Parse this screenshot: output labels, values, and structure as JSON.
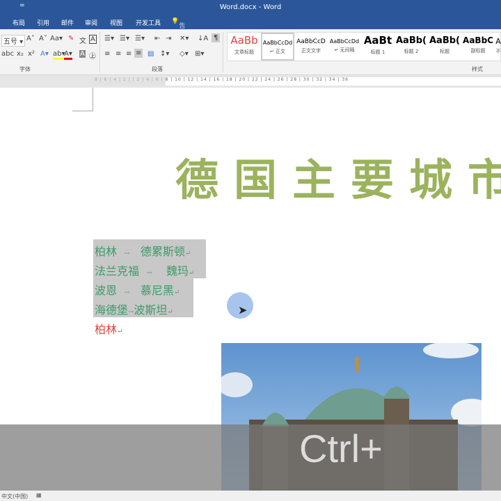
{
  "window": {
    "title": "Word.docx - Word",
    "quick_access": "="
  },
  "tabs": [
    "布局",
    "引用",
    "邮件",
    "审阅",
    "视图",
    "开发工具"
  ],
  "tell_me": "告诉我您想要做什么...",
  "font": {
    "size": "五号",
    "group_label": "字体"
  },
  "paragraph": {
    "group_label": "段落"
  },
  "styles": {
    "group_label": "样式",
    "items": [
      {
        "preview": "AaBb",
        "name": "文章标题"
      },
      {
        "preview": "AaBbCcDd",
        "name": "↵ 正文"
      },
      {
        "preview": "AaBbCcD",
        "name": "正文文字"
      },
      {
        "preview": "AaBbCcDd",
        "name": "↵ 无间隔"
      },
      {
        "preview": "AaBt",
        "name": "标题 1"
      },
      {
        "preview": "AaBb(",
        "name": "标题 2"
      },
      {
        "preview": "AaBb(",
        "name": "标题"
      },
      {
        "preview": "AaBbC",
        "name": "副标题"
      },
      {
        "preview": "A",
        "name": "不"
      }
    ]
  },
  "ruler": "8 | 6 | 4 | 2 |   | 2 | 4 | 6 | 8 | 10 | 12 | 14 | 16 | 18 | 20 | 22 | 24 | 26 | 28 | 30 | 32 | 34 | 36",
  "document": {
    "title": "德国主要城市",
    "lines": [
      {
        "a": "柏林",
        "b": "德累斯顿"
      },
      {
        "a": "法兰克福",
        "b": "魏玛"
      },
      {
        "a": "波恩",
        "b": "慕尼黑"
      },
      {
        "a": "海德堡",
        "b": "波斯坦"
      }
    ],
    "last_line": "柏林",
    "tab_mark": "→",
    "para_mark": "↵"
  },
  "overlay_text": "Ctrl+",
  "status": {
    "language": "中文(中国)"
  }
}
